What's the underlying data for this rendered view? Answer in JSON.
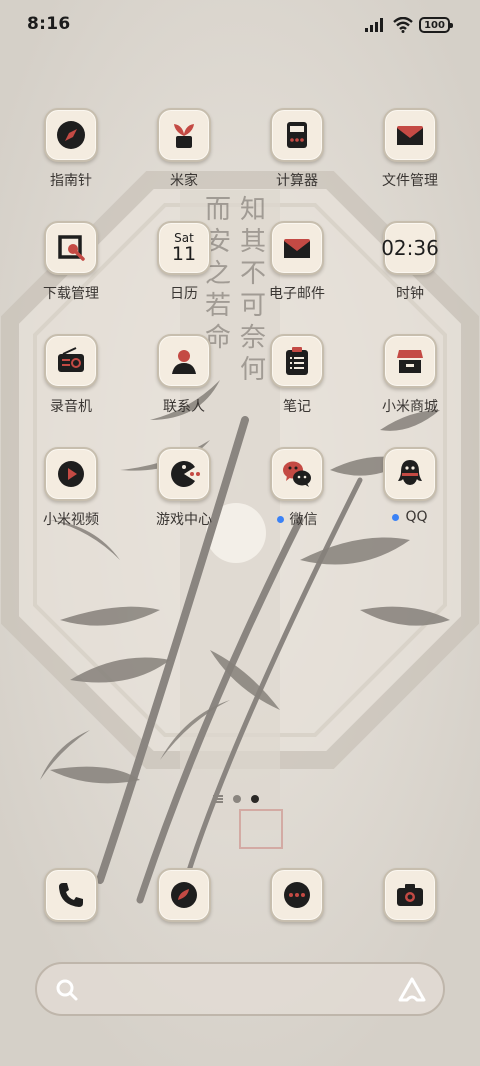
{
  "status_bar": {
    "time": "8:16",
    "battery": "100"
  },
  "apps": [
    {
      "label": "指南针",
      "icon": "compass-icon"
    },
    {
      "label": "米家",
      "icon": "plant-icon"
    },
    {
      "label": "计算器",
      "icon": "calculator-icon"
    },
    {
      "label": "文件管理",
      "icon": "folder-envelope-icon"
    },
    {
      "label": "下载管理",
      "icon": "download-icon"
    },
    {
      "label": "日历",
      "icon": "calendar-icon",
      "day": "Sat",
      "date": "11"
    },
    {
      "label": "电子邮件",
      "icon": "mail-icon"
    },
    {
      "label": "时钟",
      "icon": "clock-icon",
      "time": "02:36"
    },
    {
      "label": "录音机",
      "icon": "radio-icon"
    },
    {
      "label": "联系人",
      "icon": "person-icon"
    },
    {
      "label": "笔记",
      "icon": "notes-icon"
    },
    {
      "label": "小米商城",
      "icon": "store-icon"
    },
    {
      "label": "小米视频",
      "icon": "play-icon"
    },
    {
      "label": "游戏中心",
      "icon": "game-icon"
    },
    {
      "label": "微信",
      "icon": "wechat-icon",
      "new": true
    },
    {
      "label": "QQ",
      "icon": "qq-icon",
      "new": true
    }
  ],
  "dock": [
    {
      "name": "phone",
      "icon": "phone-icon"
    },
    {
      "name": "browser",
      "icon": "browser-icon"
    },
    {
      "name": "messages",
      "icon": "message-icon"
    },
    {
      "name": "camera",
      "icon": "camera-icon"
    }
  ],
  "colors": {
    "accent": "#c44a44",
    "ink": "#1e1e1e",
    "tile": "#f4ece0"
  }
}
